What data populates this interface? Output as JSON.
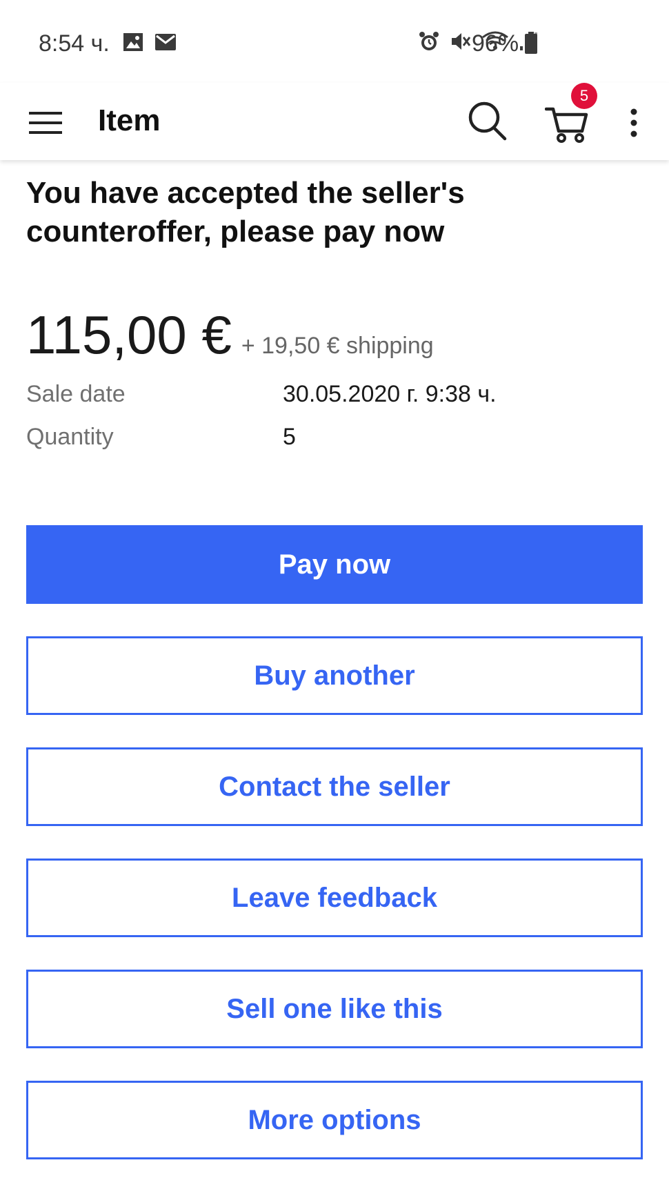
{
  "status_bar": {
    "time": "8:54 ч.",
    "battery": "96%"
  },
  "app_bar": {
    "title": "Item",
    "cart_count": "5"
  },
  "headline": "You have accepted the seller's counteroffer, please pay now",
  "price": {
    "amount": "115,00 €",
    "shipping": "+ 19,50 € shipping"
  },
  "details": [
    {
      "label": "Sale date",
      "value": "30.05.2020 г. 9:38 ч."
    },
    {
      "label": "Quantity",
      "value": "5"
    }
  ],
  "actions": {
    "pay_now": "Pay now",
    "buy_another": "Buy another",
    "contact_seller": "Contact the seller",
    "leave_feedback": "Leave feedback",
    "sell_one_like_this": "Sell one like this",
    "more_options": "More options"
  },
  "colors": {
    "primary": "#3665f3",
    "badge": "#e0103a"
  }
}
